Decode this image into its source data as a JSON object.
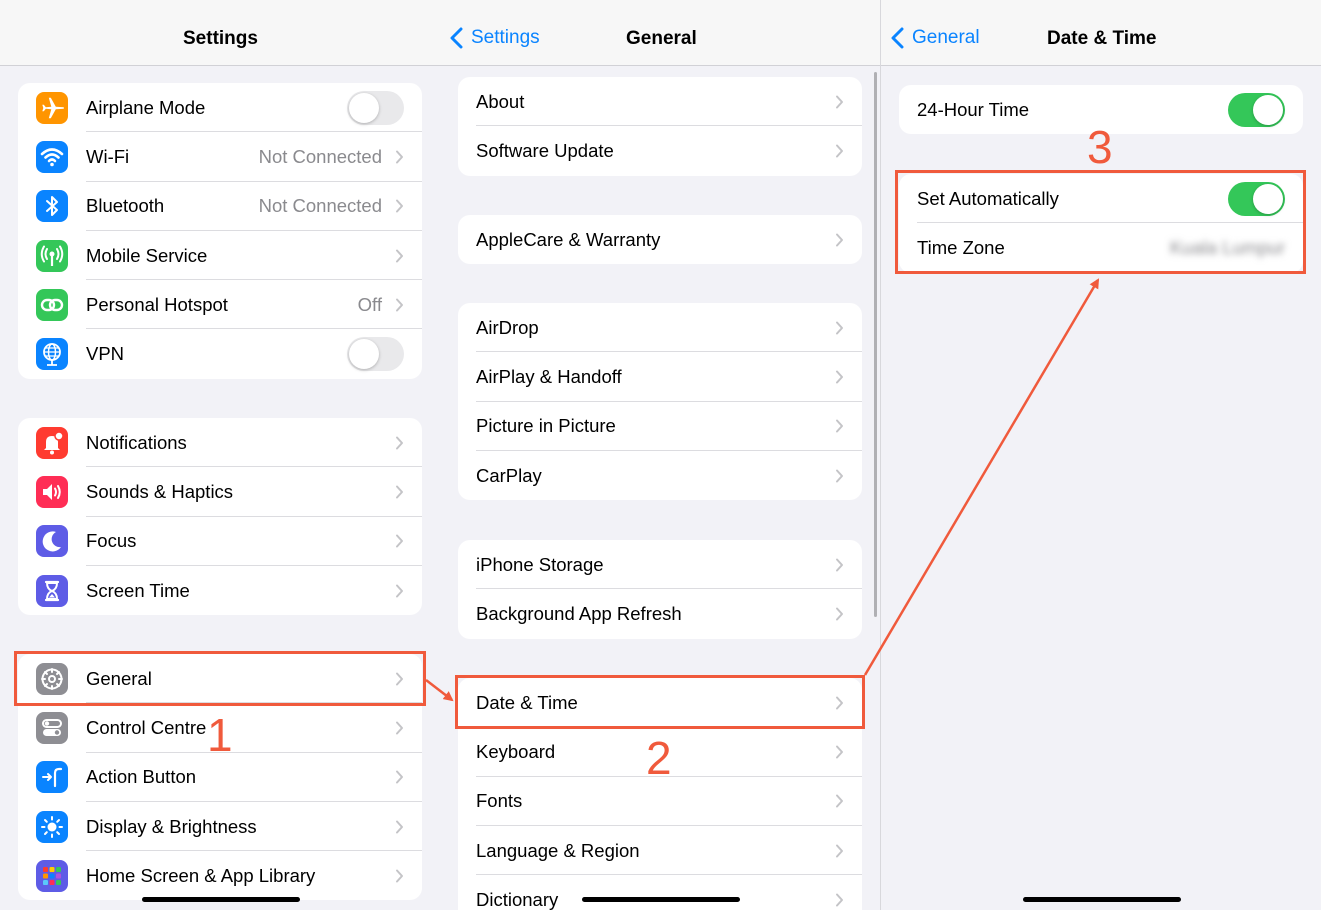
{
  "settings_panel": {
    "title": "Settings",
    "group1": [
      {
        "label": "Airplane Mode",
        "icon": "airplane-icon",
        "color": "#ff9500",
        "toggle": false
      },
      {
        "label": "Wi-Fi",
        "icon": "wifi-icon",
        "color": "#0a84ff",
        "value": "Not Connected"
      },
      {
        "label": "Bluetooth",
        "icon": "bluetooth-icon",
        "color": "#0a84ff",
        "value": "Not Connected"
      },
      {
        "label": "Mobile Service",
        "icon": "antenna-icon",
        "color": "#34c759"
      },
      {
        "label": "Personal Hotspot",
        "icon": "hotspot-icon",
        "color": "#34c759",
        "value": "Off"
      },
      {
        "label": "VPN",
        "icon": "globe-icon",
        "color": "#0a84ff",
        "toggle": false
      }
    ],
    "group2": [
      {
        "label": "Notifications",
        "icon": "bell-icon",
        "color": "#ff3b30"
      },
      {
        "label": "Sounds & Haptics",
        "icon": "speaker-icon",
        "color": "#ff2d55"
      },
      {
        "label": "Focus",
        "icon": "moon-icon",
        "color": "#5e5ce6"
      },
      {
        "label": "Screen Time",
        "icon": "hourglass-icon",
        "color": "#5e5ce6"
      }
    ],
    "group3": [
      {
        "label": "General",
        "icon": "gear-icon",
        "color": "#8e8e93"
      },
      {
        "label": "Control Centre",
        "icon": "control-toggles-icon",
        "color": "#8e8e93"
      },
      {
        "label": "Action Button",
        "icon": "action-button-icon",
        "color": "#0a84ff"
      },
      {
        "label": "Display & Brightness",
        "icon": "sun-icon",
        "color": "#0a84ff"
      },
      {
        "label": "Home Screen & App Library",
        "icon": "app-grid-icon",
        "color": "#5e5ce6"
      }
    ]
  },
  "general_panel": {
    "back_label": "Settings",
    "title": "General",
    "groups": [
      [
        "About",
        "Software Update"
      ],
      [
        "AppleCare & Warranty"
      ],
      [
        "AirDrop",
        "AirPlay & Handoff",
        "Picture in Picture",
        "CarPlay"
      ],
      [
        "iPhone Storage",
        "Background App Refresh"
      ],
      [
        "Date & Time",
        "Keyboard",
        "Fonts",
        "Language & Region",
        "Dictionary"
      ]
    ]
  },
  "datetime_panel": {
    "back_label": "General",
    "title": "Date & Time",
    "hour24": {
      "label": "24-Hour Time",
      "toggle": true
    },
    "set_auto": {
      "label": "Set Automatically",
      "toggle": true
    },
    "time_zone": {
      "label": "Time Zone",
      "value": "Kuala Lumpur"
    }
  },
  "annotations": {
    "step1": "1",
    "step2": "2",
    "step3": "3",
    "color": "#f05a3c"
  }
}
